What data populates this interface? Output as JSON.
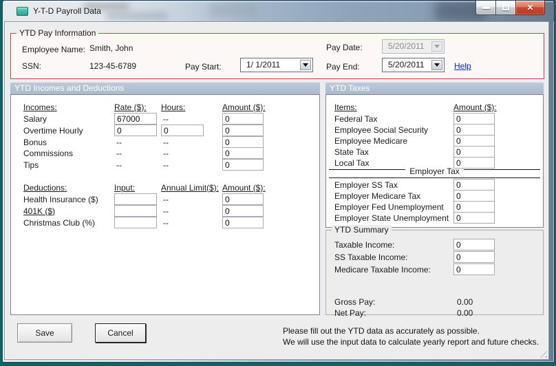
{
  "window": {
    "title": "Y-T-D Payroll Data"
  },
  "icons": {
    "close_glyph": "✕"
  },
  "pay_info": {
    "group_label": "YTD Pay Information",
    "employee_name_label": "Employee Name:",
    "employee_name_value": "Smith, John",
    "ssn_label": "SSN:",
    "ssn_value": "123-45-6789",
    "pay_start_label": "Pay Start:",
    "pay_start_value": "1/ 1/2011",
    "pay_date_label": "Pay Date:",
    "pay_date_value": "5/20/2011",
    "pay_end_label": "Pay End:",
    "pay_end_value": "5/20/2011",
    "help_label": "Help"
  },
  "incomes": {
    "section_header": "YTD Incomes and Deductions",
    "cols": [
      "Incomes:",
      "Rate ($):",
      "Hours:",
      "Amount ($):"
    ],
    "rows": [
      {
        "label": "Salary",
        "rate": "67000",
        "hours": "--",
        "amount": "0"
      },
      {
        "label": "Overtime Hourly",
        "rate": "0",
        "hours": "0",
        "amount": "0"
      },
      {
        "label": "Bonus",
        "rate": "--",
        "hours": "--",
        "amount": "0"
      },
      {
        "label": "Commissions",
        "rate": "--",
        "hours": "--",
        "amount": "0"
      },
      {
        "label": "Tips",
        "rate": "--",
        "hours": "--",
        "amount": "0"
      }
    ]
  },
  "deductions": {
    "cols": [
      "Deductions:",
      "Input:",
      "Annual Limit($):",
      "Amount ($):"
    ],
    "rows": [
      {
        "label": "Health Insurance ($)",
        "input": "",
        "limit": "--",
        "amount": "0"
      },
      {
        "label": "401K ($)",
        "input": "",
        "limit": "--",
        "amount": "0"
      },
      {
        "label": "Christmas Club (%)",
        "input": "",
        "limit": "--",
        "amount": "0"
      }
    ]
  },
  "taxes": {
    "section_header": "YTD Taxes",
    "items_col": "Items:",
    "amount_col": "Amount ($):",
    "employee_rows": [
      {
        "label": "Federal Tax",
        "amount": "0"
      },
      {
        "label": "Employee Social Security",
        "amount": "0"
      },
      {
        "label": "Employee Medicare",
        "amount": "0"
      },
      {
        "label": "State Tax",
        "amount": "0"
      },
      {
        "label": "Local Tax",
        "amount": "0"
      }
    ],
    "employer_header": "Employer Tax",
    "employer_rows": [
      {
        "label": "Employer SS Tax",
        "amount": "0"
      },
      {
        "label": "Employer Medicare Tax",
        "amount": "0"
      },
      {
        "label": "Employer Fed Unemployment",
        "amount": "0"
      },
      {
        "label": "Employer State Unemployment",
        "amount": "0"
      }
    ]
  },
  "summary": {
    "group_label": "YTD Summary",
    "rows": [
      {
        "label": "Taxable Income:",
        "amount": "0"
      },
      {
        "label": "SS Taxable Income:",
        "amount": "0"
      },
      {
        "label": "Medicare Taxable Income:",
        "amount": "0"
      }
    ],
    "gross_pay_label": "Gross Pay:",
    "gross_pay_value": "0.00",
    "net_pay_label": "Net Pay:",
    "net_pay_value": "0.00"
  },
  "footer": {
    "save_label": "Save",
    "cancel_label": "Cancel",
    "note_line1": "Please fill out the YTD data as accurately as possible.",
    "note_line2": "We will use the input data to calculate yearly report and future checks."
  },
  "colors": {
    "section_header_bg": "#B1C1D3",
    "pay_info_border": "#BE4B48",
    "help_link": "#0026E8",
    "desktop_background": "#0B6565"
  }
}
